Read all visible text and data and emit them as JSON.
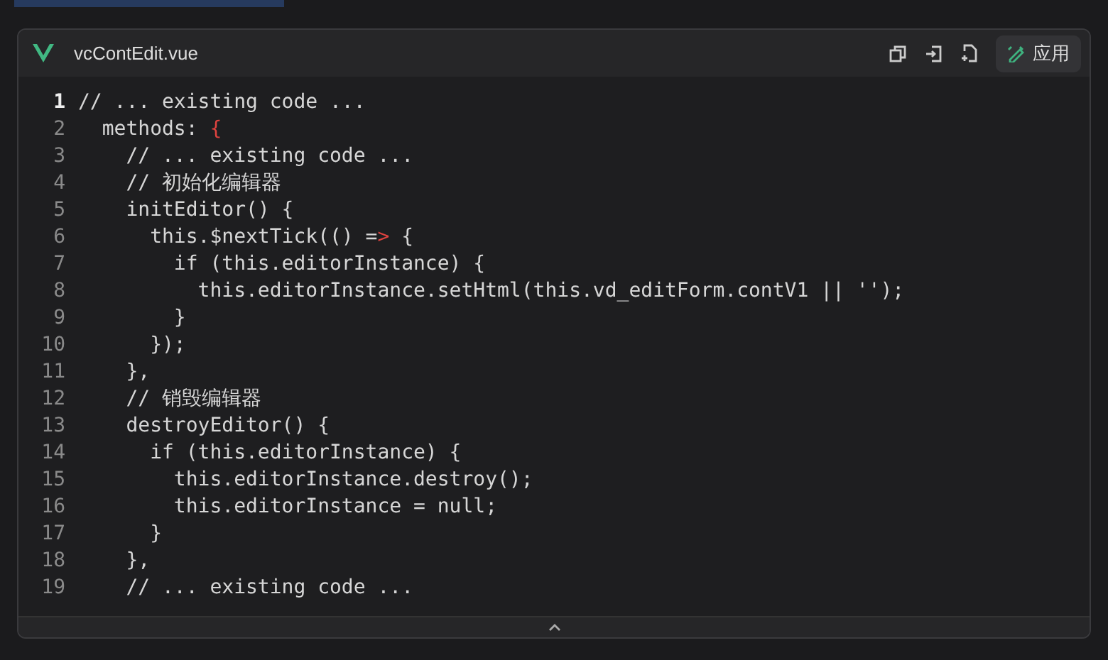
{
  "file": {
    "name": "vcContEdit.vue",
    "actions": [
      "应用"
    ]
  },
  "lines": [
    {
      "number": "1",
      "selected": true,
      "segments": [
        {
          "kind": "plain",
          "text": "// ... existing code ..."
        }
      ]
    },
    {
      "number": "2",
      "selected": false,
      "segments": [
        {
          "kind": "plain",
          "text": "  methods: "
        },
        {
          "kind": "error",
          "text": "{"
        }
      ]
    },
    {
      "number": "3",
      "selected": false,
      "segments": [
        {
          "kind": "plain",
          "text": "    // ... existing code ..."
        }
      ]
    },
    {
      "number": "4",
      "selected": false,
      "segments": [
        {
          "kind": "plain",
          "text": "    // 初始化编辑器"
        }
      ]
    },
    {
      "number": "5",
      "selected": false,
      "segments": [
        {
          "kind": "plain",
          "text": "    initEditor() {"
        }
      ]
    },
    {
      "number": "6",
      "selected": false,
      "segments": [
        {
          "kind": "plain",
          "text": "      this.$nextTick(() ="
        },
        {
          "kind": "error",
          "text": ">"
        },
        {
          "kind": "plain",
          "text": " {"
        }
      ]
    },
    {
      "number": "7",
      "selected": false,
      "segments": [
        {
          "kind": "plain",
          "text": "        if (this.editorInstance) {"
        }
      ]
    },
    {
      "number": "8",
      "selected": false,
      "segments": [
        {
          "kind": "plain",
          "text": "          this.editorInstance.setHtml(this.vd_editForm.contV1 || '');"
        }
      ]
    },
    {
      "number": "9",
      "selected": false,
      "segments": [
        {
          "kind": "plain",
          "text": "        }"
        }
      ]
    },
    {
      "number": "10",
      "selected": false,
      "segments": [
        {
          "kind": "plain",
          "text": "      });"
        }
      ]
    },
    {
      "number": "11",
      "selected": false,
      "segments": [
        {
          "kind": "plain",
          "text": "    },"
        }
      ]
    },
    {
      "number": "12",
      "selected": false,
      "segments": [
        {
          "kind": "plain",
          "text": "    // 销毁编辑器"
        }
      ]
    },
    {
      "number": "13",
      "selected": false,
      "segments": [
        {
          "kind": "plain",
          "text": "    destroyEditor() {"
        }
      ]
    },
    {
      "number": "14",
      "selected": false,
      "segments": [
        {
          "kind": "plain",
          "text": "      if (this.editorInstance) {"
        }
      ]
    },
    {
      "number": "15",
      "selected": false,
      "segments": [
        {
          "kind": "plain",
          "text": "        this.editorInstance.destroy();"
        }
      ]
    },
    {
      "number": "16",
      "selected": false,
      "segments": [
        {
          "kind": "plain",
          "text": "        this.editorInstance = null;"
        }
      ]
    },
    {
      "number": "17",
      "selected": false,
      "segments": [
        {
          "kind": "plain",
          "text": "      }"
        }
      ]
    },
    {
      "number": "18",
      "selected": false,
      "segments": [
        {
          "kind": "plain",
          "text": "    },"
        }
      ]
    },
    {
      "number": "19",
      "selected": false,
      "segments": [
        {
          "kind": "plain",
          "text": "    // ... existing code ..."
        }
      ]
    }
  ]
}
